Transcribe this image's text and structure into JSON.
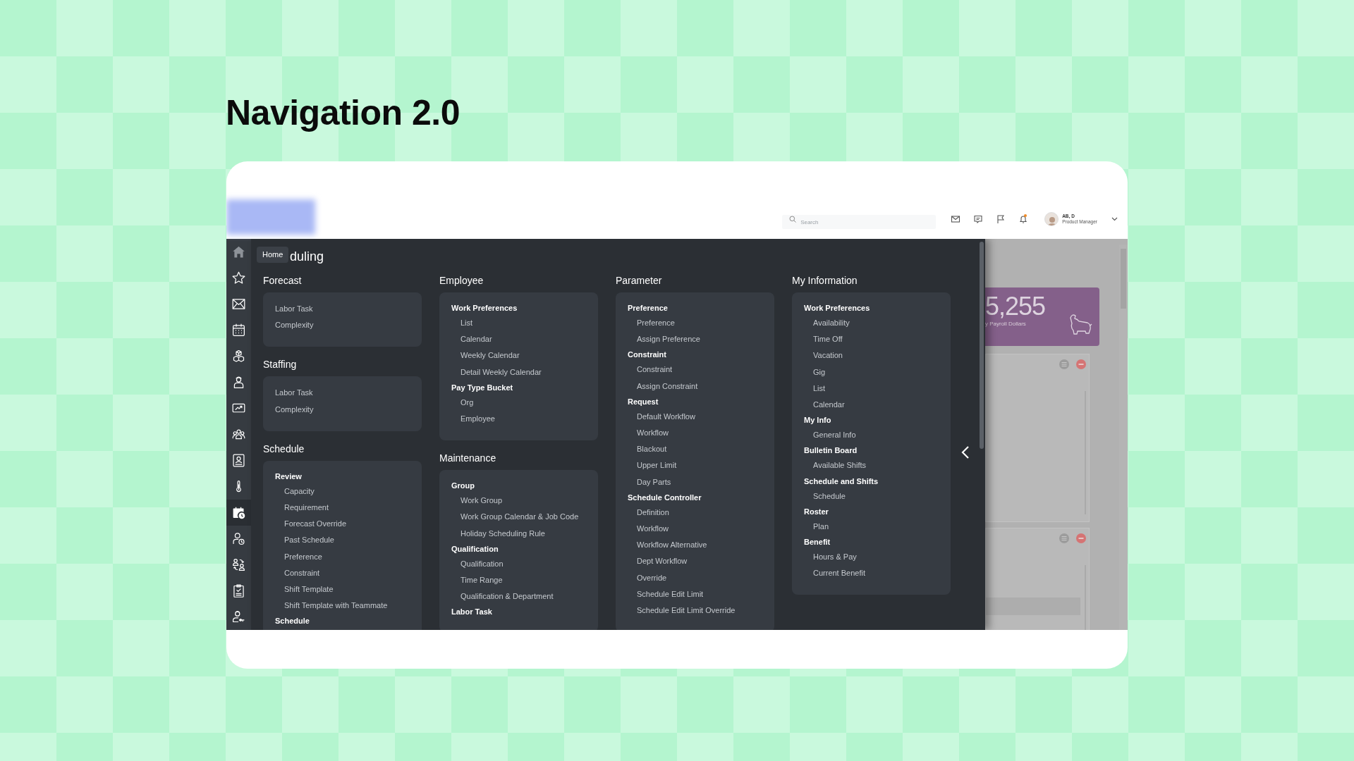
{
  "page_title": "Navigation 2.0",
  "header": {
    "search": {
      "placeholder": "Search"
    },
    "notification": true,
    "user": {
      "name": "AB, D",
      "role": "Product Manager"
    }
  },
  "sidebar": {
    "tooltip": "Home",
    "items": [
      {
        "selected": false
      },
      {
        "selected": false
      },
      {
        "selected": false
      },
      {
        "selected": false
      },
      {
        "selected": false
      },
      {
        "selected": false
      },
      {
        "selected": false
      },
      {
        "selected": false
      },
      {
        "selected": false
      },
      {
        "selected": false
      },
      {
        "selected": true
      },
      {
        "selected": false
      },
      {
        "selected": false
      },
      {
        "selected": false
      },
      {
        "selected": false
      }
    ]
  },
  "drawer": {
    "title": "duling",
    "columns": [
      [
        {
          "title": "Forecast",
          "items": [
            {
              "kind": "link",
              "label": "Labor Task"
            },
            {
              "kind": "link",
              "label": "Complexity"
            }
          ]
        },
        {
          "title": "Staffing",
          "items": [
            {
              "kind": "link",
              "label": "Labor Task"
            },
            {
              "kind": "link",
              "label": "Complexity"
            }
          ]
        },
        {
          "title": "Schedule",
          "items": [
            {
              "kind": "group",
              "label": "Review",
              "children": [
                {
                  "kind": "link",
                  "label": "Capacity"
                },
                {
                  "kind": "link",
                  "label": "Requirement"
                },
                {
                  "kind": "link",
                  "label": "Forecast Override"
                },
                {
                  "kind": "link",
                  "label": "Past Schedule"
                },
                {
                  "kind": "link",
                  "label": "Preference"
                },
                {
                  "kind": "link",
                  "label": "Constraint"
                },
                {
                  "kind": "link",
                  "label": "Shift Template"
                },
                {
                  "kind": "link",
                  "label": "Shift Template with Teammate"
                }
              ]
            },
            {
              "kind": "group",
              "label": "Schedule"
            }
          ]
        }
      ],
      [
        {
          "title": "Employee",
          "items": [
            {
              "kind": "group",
              "label": "Work Preferences",
              "children": [
                {
                  "kind": "link",
                  "label": "List"
                },
                {
                  "kind": "link",
                  "label": "Calendar"
                },
                {
                  "kind": "link",
                  "label": "Weekly Calendar"
                },
                {
                  "kind": "link",
                  "label": "Detail Weekly Calendar"
                }
              ]
            },
            {
              "kind": "group",
              "label": "Pay Type Bucket",
              "children": [
                {
                  "kind": "link",
                  "label": "Org"
                },
                {
                  "kind": "link",
                  "label": "Employee"
                }
              ]
            }
          ]
        },
        {
          "title": "Maintenance",
          "items": [
            {
              "kind": "group",
              "label": "Group",
              "children": [
                {
                  "kind": "link",
                  "label": "Work Group"
                },
                {
                  "kind": "link",
                  "label": "Work Group Calendar & Job Code"
                },
                {
                  "kind": "link",
                  "label": "Holiday Scheduling Rule"
                }
              ]
            },
            {
              "kind": "group",
              "label": "Qualification",
              "children": [
                {
                  "kind": "link",
                  "label": "Qualification"
                },
                {
                  "kind": "link",
                  "label": "Time Range"
                },
                {
                  "kind": "link",
                  "label": "Qualification & Department"
                }
              ]
            },
            {
              "kind": "group",
              "label": "Labor Task"
            }
          ]
        }
      ],
      [
        {
          "title": "Parameter",
          "items": [
            {
              "kind": "group",
              "label": "Preference",
              "children": [
                {
                  "kind": "link",
                  "label": "Preference"
                },
                {
                  "kind": "link",
                  "label": "Assign Preference"
                }
              ]
            },
            {
              "kind": "group",
              "label": "Constraint",
              "children": [
                {
                  "kind": "link",
                  "label": "Constraint"
                },
                {
                  "kind": "link",
                  "label": "Assign Constraint"
                }
              ]
            },
            {
              "kind": "group",
              "label": "Request",
              "children": [
                {
                  "kind": "link",
                  "label": "Default Workflow"
                },
                {
                  "kind": "link",
                  "label": "Workflow"
                },
                {
                  "kind": "link",
                  "label": "Blackout"
                },
                {
                  "kind": "link",
                  "label": "Upper Limit"
                },
                {
                  "kind": "link",
                  "label": "Day Parts"
                }
              ]
            },
            {
              "kind": "group",
              "label": "Schedule Controller",
              "children": [
                {
                  "kind": "link",
                  "label": "Definition"
                },
                {
                  "kind": "link",
                  "label": "Workflow"
                },
                {
                  "kind": "link",
                  "label": "Workflow Alternative"
                },
                {
                  "kind": "link",
                  "label": "Dept Workflow"
                },
                {
                  "kind": "link",
                  "label": "Override"
                },
                {
                  "kind": "link",
                  "label": "Schedule Edit Limit"
                },
                {
                  "kind": "link",
                  "label": "Schedule Edit Limit Override"
                }
              ]
            }
          ]
        }
      ],
      [
        {
          "title": "My Information",
          "items": [
            {
              "kind": "group",
              "label": "Work Preferences",
              "children": [
                {
                  "kind": "link",
                  "label": "Availability"
                },
                {
                  "kind": "link",
                  "label": "Time Off"
                },
                {
                  "kind": "link",
                  "label": "Vacation"
                },
                {
                  "kind": "link",
                  "label": "Gig"
                },
                {
                  "kind": "link",
                  "label": "List"
                },
                {
                  "kind": "link",
                  "label": "Calendar"
                }
              ]
            },
            {
              "kind": "group",
              "label": "My Info",
              "children": [
                {
                  "kind": "link",
                  "label": "General Info"
                }
              ]
            },
            {
              "kind": "group",
              "label": "Bulletin Board",
              "children": [
                {
                  "kind": "link",
                  "label": "Available Shifts"
                }
              ]
            },
            {
              "kind": "group",
              "label": "Schedule and Shifts",
              "children": [
                {
                  "kind": "link",
                  "label": "Schedule"
                }
              ]
            },
            {
              "kind": "group",
              "label": "Roster",
              "children": [
                {
                  "kind": "link",
                  "label": "Plan"
                }
              ]
            },
            {
              "kind": "group",
              "label": "Benefit",
              "children": [
                {
                  "kind": "link",
                  "label": "Hours & Pay"
                },
                {
                  "kind": "link",
                  "label": "Current Benefit"
                }
              ]
            }
          ]
        }
      ]
    ]
  },
  "background": {
    "kpi": {
      "value": "5,255",
      "label": "y Payroll Dollars"
    }
  }
}
